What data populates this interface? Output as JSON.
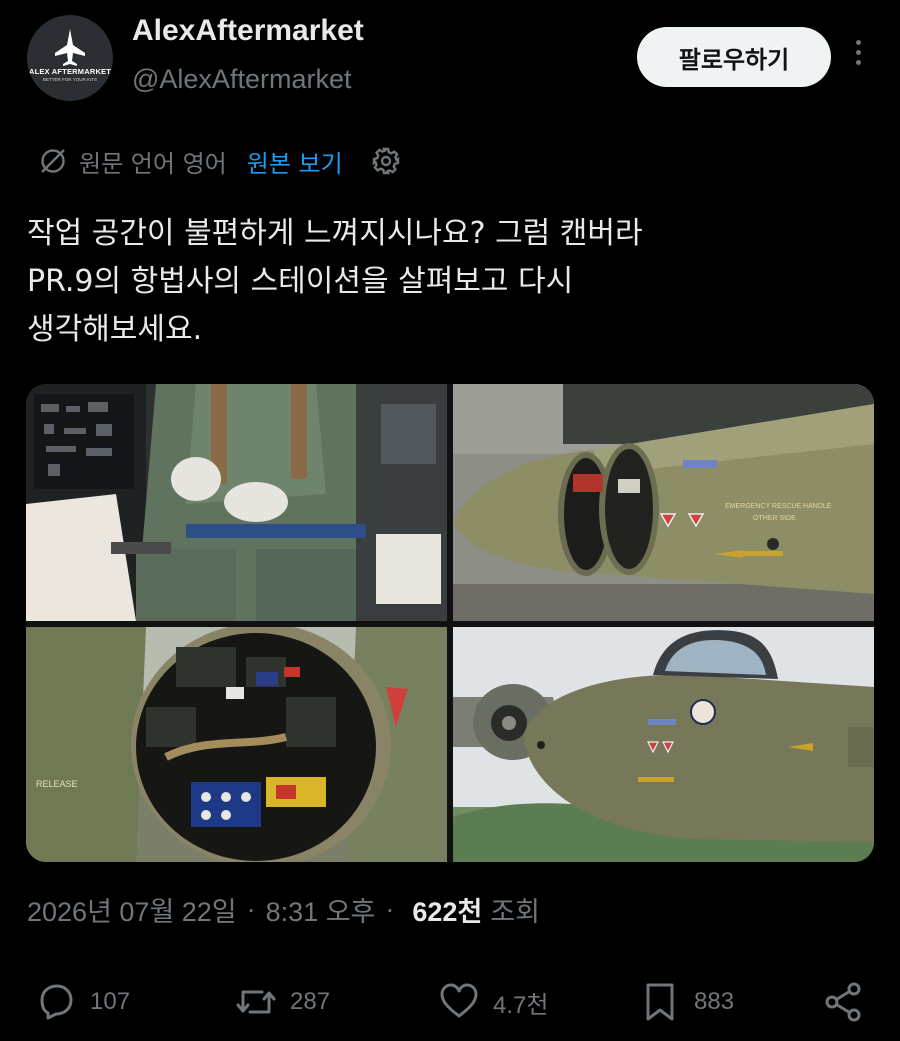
{
  "profile": {
    "avatar_brand": "ALEX AFTERMARKET",
    "avatar_tagline": "BETTER FOR YOUR KITS",
    "display_name": "AlexAftermarket",
    "handle": "@AlexAftermarket"
  },
  "header": {
    "follow_label": "팔로우하기",
    "more_icon": "more-vertical-icon"
  },
  "translation": {
    "source_label": "원문 언어 영어",
    "show_original_label": "원본 보기"
  },
  "tweet": {
    "text_lines": [
      "작업 공간이 불편하게 느껴지시나요? 그럼 캔버라",
      "PR.9의 항법사의 스테이션을 살펴보고 다시",
      "생각해보세요."
    ]
  },
  "media": {
    "photos": [
      {
        "subject": "cockpit-crew-seat-photo"
      },
      {
        "subject": "open-nose-hatch-photo",
        "marking_1": "EMERGENCY RESCUE HANDLE",
        "marking_2": "OTHER SIDE"
      },
      {
        "subject": "navigator-station-interior-photo",
        "marking": "RELEASE"
      },
      {
        "subject": "aircraft-nose-flying-photo"
      }
    ]
  },
  "meta": {
    "date": "2026년 07월 22일",
    "separator": "·",
    "time": "8:31 오후",
    "views_count": "622천",
    "views_label": "조회"
  },
  "actions": {
    "replies": "107",
    "reposts": "287",
    "likes": "4.7천",
    "bookmarks": "883"
  },
  "colors": {
    "background": "#000000",
    "primary_text": "#e7e9ea",
    "secondary_text": "#71767b",
    "link_blue": "#1d9bf0",
    "follow_button_bg": "#eff3f4"
  }
}
